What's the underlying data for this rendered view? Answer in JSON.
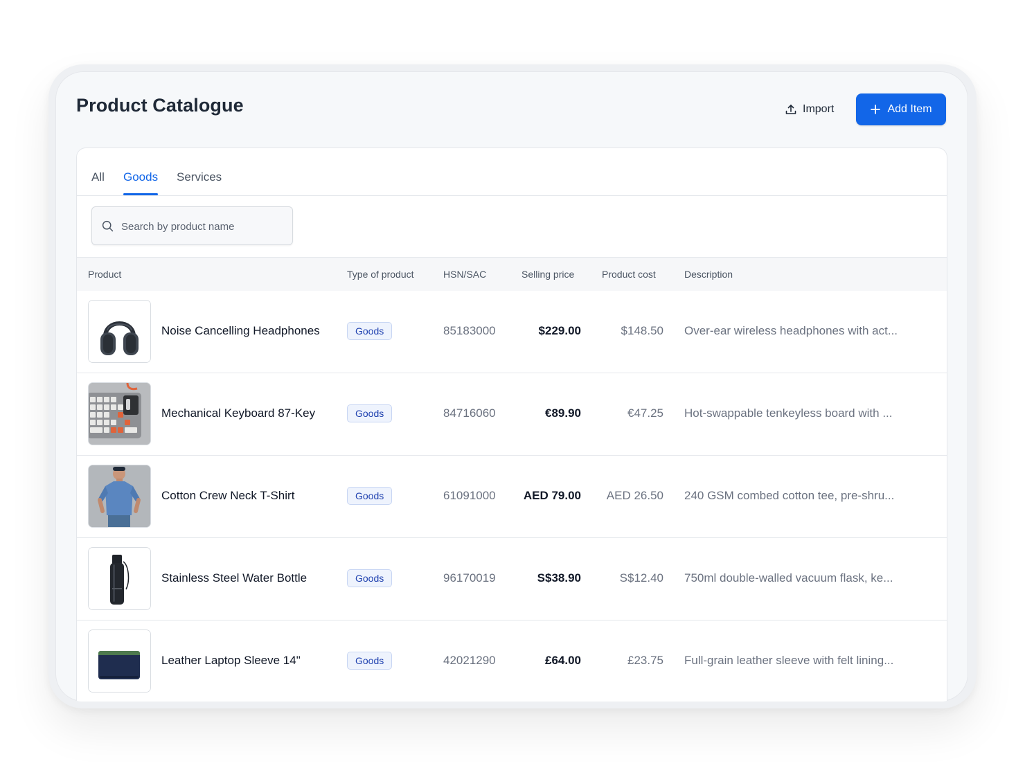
{
  "header": {
    "title": "Product Catalogue",
    "import_label": "Import",
    "add_label": "Add Item",
    "accent_color": "#1266e8"
  },
  "tabs": [
    {
      "label": "All",
      "active": false
    },
    {
      "label": "Goods",
      "active": true
    },
    {
      "label": "Services",
      "active": false
    }
  ],
  "search": {
    "placeholder": "Search by product name",
    "value": ""
  },
  "table": {
    "columns": [
      "Product",
      "Type of product",
      "HSN/SAC",
      "Selling price",
      "Product cost",
      "Description"
    ],
    "rows": [
      {
        "name": "Noise Cancelling Headphones",
        "type": "Goods",
        "hsn": "85183000",
        "selling_price": "$229.00",
        "product_cost": "$148.50",
        "description": "Over-ear wireless headphones with act...",
        "image_icon": "headphones-image"
      },
      {
        "name": "Mechanical Keyboard 87-Key",
        "type": "Goods",
        "hsn": "84716060",
        "selling_price": "€89.90",
        "product_cost": "€47.25",
        "description": "Hot-swappable tenkeyless board with ...",
        "image_icon": "keyboard-image"
      },
      {
        "name": "Cotton Crew Neck T-Shirt",
        "type": "Goods",
        "hsn": "61091000",
        "selling_price": "AED 79.00",
        "product_cost": "AED 26.50",
        "description": "240 GSM combed cotton tee, pre-shru...",
        "image_icon": "tshirt-image"
      },
      {
        "name": "Stainless Steel Water Bottle",
        "type": "Goods",
        "hsn": "96170019",
        "selling_price": "S$38.90",
        "product_cost": "S$12.40",
        "description": "750ml double-walled vacuum flask, ke...",
        "image_icon": "bottle-image"
      },
      {
        "name": "Leather Laptop Sleeve 14\"",
        "type": "Goods",
        "hsn": "42021290",
        "selling_price": "£64.00",
        "product_cost": "£23.75",
        "description": "Full-grain leather sleeve with felt lining...",
        "image_icon": "laptop-sleeve-image"
      }
    ]
  }
}
